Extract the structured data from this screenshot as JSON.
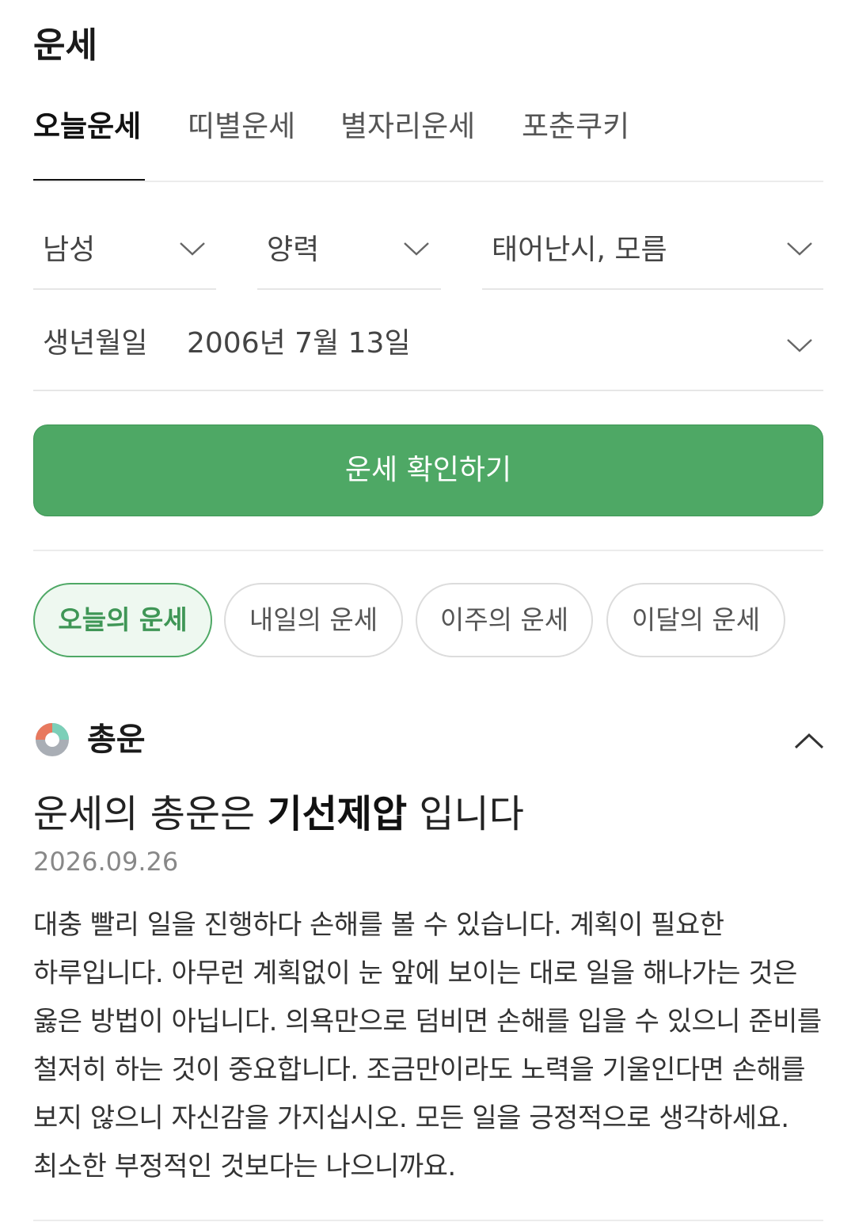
{
  "header": {
    "title": "운세"
  },
  "tabs": [
    {
      "label": "오늘운세",
      "active": true
    },
    {
      "label": "띠별운세",
      "active": false
    },
    {
      "label": "별자리운세",
      "active": false
    },
    {
      "label": "포춘쿠키",
      "active": false
    }
  ],
  "form": {
    "gender": {
      "value": "남성",
      "icon": "chevron-down-icon"
    },
    "calendar": {
      "value": "양력",
      "icon": "chevron-down-icon"
    },
    "birth_time": {
      "value": "태어난시, 모름",
      "icon": "chevron-down-icon"
    },
    "birthdate": {
      "label": "생년월일",
      "value": "2006년 7월 13일",
      "icon": "chevron-down-icon"
    },
    "submit_label": "운세 확인하기"
  },
  "period_chips": [
    {
      "label": "오늘의 운세",
      "active": true
    },
    {
      "label": "내일의 운세",
      "active": false
    },
    {
      "label": "이주의 운세",
      "active": false
    },
    {
      "label": "이달의 운세",
      "active": false
    }
  ],
  "fortune": {
    "section_title": "총운",
    "section_icon": "donut-chart-icon",
    "collapse_icon": "chevron-up-icon",
    "headline_prefix": "운세의 총운은 ",
    "headline_keyword": "기선제압",
    "headline_suffix": " 입니다",
    "date": "2026.09.26",
    "body": "대충 빨리 일을 진행하다 손해를 볼 수 있습니다. 계획이 필요한 하루입니다. 아무런 계획없이 눈 앞에 보이는 대로 일을 해나가는 것은 옳은 방법이 아닙니다. 의욕만으로 덤비면 손해를 입을 수 있으니 준비를 철저히 하는 것이 중요합니다. 조금만이라도 노력을 기울인다면 손해를 보지 않으니 자신감을 가지십시오. 모든 일을 긍정적으로 생각하세요. 최소한 부정적인 것보다는 나으니까요."
  },
  "colors": {
    "accent": "#4ea865",
    "accent_light_bg": "#eef8f0",
    "donut": [
      "#e8795e",
      "#7ccfb8",
      "#a9aeb5"
    ]
  }
}
